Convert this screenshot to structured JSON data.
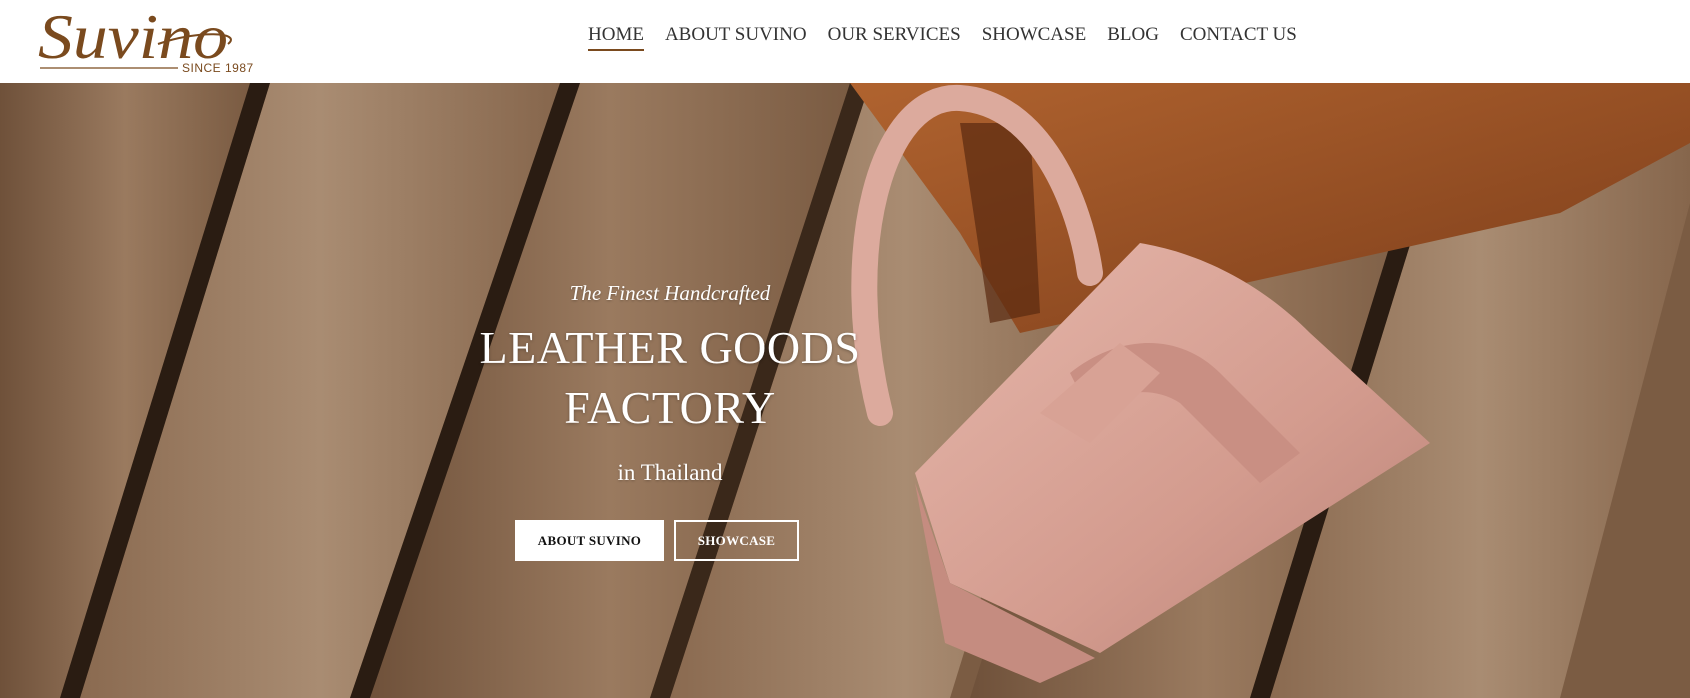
{
  "brand": {
    "logo_text": "Suvino",
    "tagline": "SINCE 1987",
    "color": "#7a4a1e"
  },
  "nav": {
    "items": [
      {
        "label": "HOME",
        "active": true
      },
      {
        "label": "ABOUT SUVINO",
        "active": false
      },
      {
        "label": "OUR SERVICES",
        "active": false
      },
      {
        "label": "SHOWCASE",
        "active": false
      },
      {
        "label": "BLOG",
        "active": false
      },
      {
        "label": "CONTACT US",
        "active": false
      }
    ]
  },
  "hero": {
    "eyebrow": "The Finest Handcrafted",
    "title_line1": "LEATHER GOODS",
    "title_line2": "FACTORY",
    "subtitle": "in Thailand",
    "primary_button": "ABOUT SUVINO",
    "secondary_button": "SHOWCASE",
    "image": "pink-leather-handbag-on-wooden-planks"
  },
  "colors": {
    "accent": "#7a4a1e",
    "nav_text": "#333333",
    "bag_pink": "#d9a69a",
    "bag_brown": "#9a5128",
    "wood": "#8c6a4f"
  }
}
